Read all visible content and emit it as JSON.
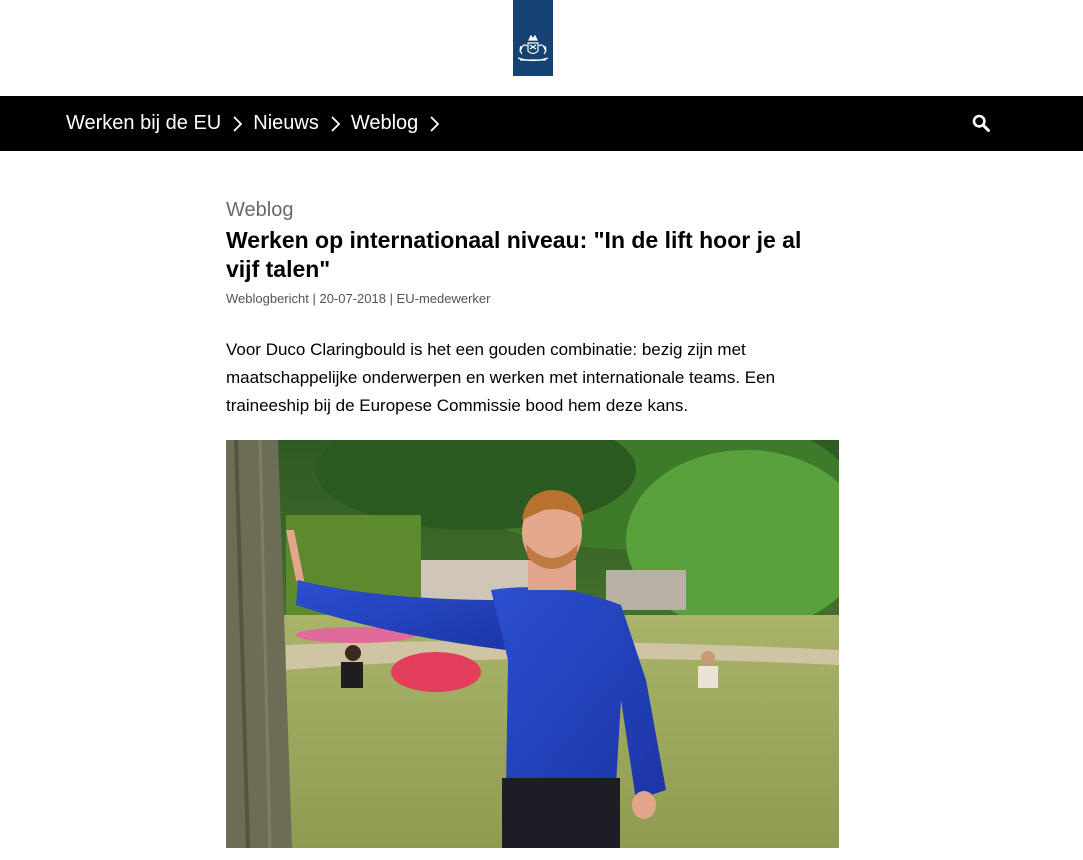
{
  "header": {
    "logo_icon": "coat-of-arms-icon",
    "brand_color": "#154273"
  },
  "nav": {
    "breadcrumbs": [
      {
        "label": "Werken bij de EU"
      },
      {
        "label": "Nieuws"
      },
      {
        "label": "Weblog"
      }
    ],
    "search_icon": "search-icon"
  },
  "article": {
    "kicker": "Weblog",
    "title": "Werken op internationaal niveau: \"In de lift hoor je al vijf talen\"",
    "meta": "Weblogbericht | 20-07-2018 | EU-medewerker",
    "intro": "Voor Duco Claringbould is het een gouden combinatie: bezig zijn met maatschappelijke onderwerpen en werken met internationale teams. Een traineeship bij de Europese Commissie bood hem deze kans."
  }
}
